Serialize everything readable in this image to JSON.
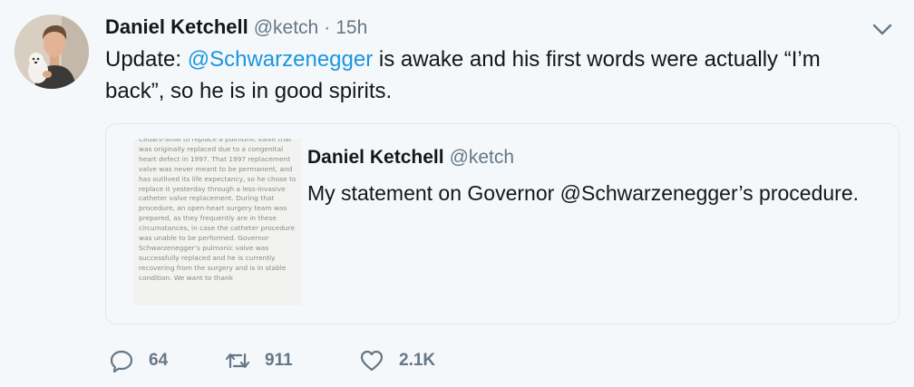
{
  "tweet": {
    "author_name": "Daniel Ketchell",
    "handle": "@ketch",
    "separator": "·",
    "timestamp": "15h",
    "text_before": "Update: ",
    "mention": "@Schwarzenegger",
    "text_after": " is awake and his first words were actually “I’m back”, so he is in good spirits."
  },
  "quote": {
    "author_name": "Daniel Ketchell",
    "handle": "@ketch",
    "text": "My statement on Governor @Schwarzenegger’s procedure.",
    "thumbnail_text": "Cedars-Sinai to replace a pulmonic valve that was originally replaced due to a congenital heart defect in 1997. That 1997 replacement valve was never meant to be permanent, and has outlived its life expectancy, so he chose to replace it yesterday through a less-invasive catheter valve replacement. During that procedure, an open-heart surgery team was prepared, as they frequently are in these circumstances, in case the catheter procedure was unable to be performed. Governor Schwarzenegger’s pulmonic valve was successfully replaced and he is currently recovering from the surgery and is in stable condition. We want to thank"
  },
  "actions": {
    "replies": "64",
    "retweets": "911",
    "likes": "2.1K"
  },
  "colors": {
    "link": "#1b95e0",
    "secondary": "#657786",
    "background": "#f5f8fa",
    "border": "#e1e8ed"
  },
  "icons": [
    "avatar-photo",
    "chevron-down-icon",
    "reply-icon",
    "retweet-icon",
    "heart-icon"
  ]
}
